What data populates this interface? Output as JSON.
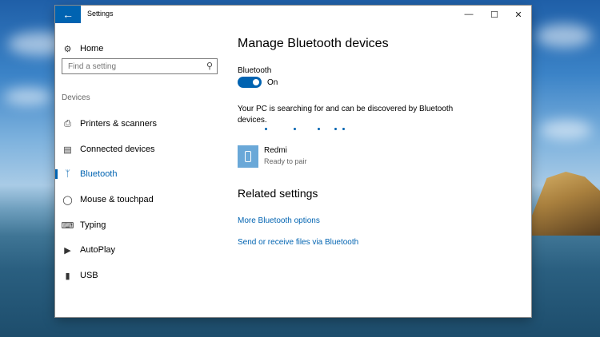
{
  "window": {
    "title": "Settings",
    "back_icon": "back-arrow-icon",
    "minimize_glyph": "—",
    "maximize_glyph": "☐",
    "close_glyph": "✕"
  },
  "sidebar": {
    "home": {
      "label": "Home",
      "icon": "gear-icon"
    },
    "search": {
      "placeholder": "Find a setting",
      "icon": "search-icon"
    },
    "section_label": "Devices",
    "items": [
      {
        "label": "Printers & scanners",
        "icon": "printer-icon",
        "active": false
      },
      {
        "label": "Connected devices",
        "icon": "devices-icon",
        "active": false
      },
      {
        "label": "Bluetooth",
        "icon": "bluetooth-icon",
        "active": true
      },
      {
        "label": "Mouse & touchpad",
        "icon": "mouse-icon",
        "active": false
      },
      {
        "label": "Typing",
        "icon": "keyboard-icon",
        "active": false
      },
      {
        "label": "AutoPlay",
        "icon": "autoplay-icon",
        "active": false
      },
      {
        "label": "USB",
        "icon": "usb-icon",
        "active": false
      }
    ]
  },
  "main": {
    "title": "Manage Bluetooth devices",
    "bluetooth_label": "Bluetooth",
    "toggle_state": "On",
    "toggle_on": true,
    "description": "Your PC is searching for and can be discovered by Bluetooth devices.",
    "devices": [
      {
        "name": "Redmi",
        "status": "Ready to pair",
        "icon": "phone-icon"
      }
    ],
    "related_title": "Related settings",
    "links": [
      "More Bluetooth options",
      "Send or receive files via Bluetooth"
    ]
  },
  "colors": {
    "accent": "#0063b1",
    "device_tile": "#6aa8d8"
  }
}
